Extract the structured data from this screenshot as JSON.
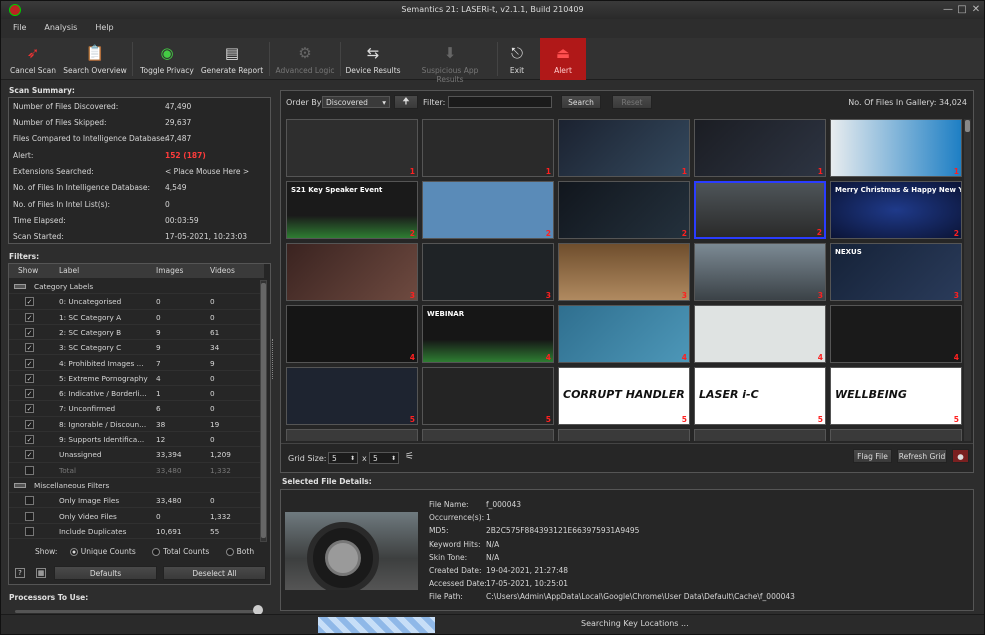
{
  "window": {
    "title": "Semantics 21: LASERi-t, v2.1.1, Build 210409"
  },
  "menu": [
    "File",
    "Analysis",
    "Help"
  ],
  "toolbar": [
    {
      "label": "Cancel Scan",
      "icon": "rocket-icon",
      "enabled": true
    },
    {
      "label": "Search Overview",
      "icon": "clipboard-icon",
      "enabled": true
    },
    {
      "label": "Toggle Privacy",
      "icon": "eye-icon",
      "enabled": true
    },
    {
      "label": "Generate Report",
      "icon": "report-icon",
      "enabled": true
    },
    {
      "label": "Advanced Logic",
      "icon": "logic-icon",
      "enabled": false
    },
    {
      "label": "Device Results",
      "icon": "usb-icon",
      "enabled": true
    },
    {
      "label": "Suspicious App Results",
      "icon": "app-icon",
      "enabled": false
    },
    {
      "label": "Exit",
      "icon": "exit-icon",
      "enabled": true
    },
    {
      "label": "Alert",
      "icon": "alarm-icon",
      "enabled": true
    }
  ],
  "scan_summary": {
    "title": "Scan Summary:",
    "rows": [
      {
        "label": "Number of Files Discovered:",
        "value": "47,490"
      },
      {
        "label": "Number of Files Skipped:",
        "value": "29,637"
      },
      {
        "label": "Files Compared to Intelligence Database:",
        "value": "47,487"
      },
      {
        "label": "Alert:",
        "value": "152 (187)"
      },
      {
        "label": "Extensions Searched:",
        "value": "< Place Mouse Here >"
      },
      {
        "label": "No. of Files In Intelligence Database:",
        "value": "4,549"
      },
      {
        "label": "No. of Files In Intel List(s):",
        "value": "0"
      },
      {
        "label": "Time Elapsed:",
        "value": "00:03:59"
      },
      {
        "label": "Scan Started:",
        "value": "17-05-2021, 10:23:03"
      }
    ]
  },
  "filters": {
    "title": "Filters:",
    "columns": [
      "Show",
      "Label",
      "Images",
      "Videos"
    ],
    "rows": [
      {
        "type": "group",
        "label": "Category Labels"
      },
      {
        "checked": true,
        "label": "0: Uncategorised",
        "images": "0",
        "videos": "0"
      },
      {
        "checked": true,
        "label": "1: SC Category A",
        "images": "0",
        "videos": "0"
      },
      {
        "checked": true,
        "label": "2: SC Category B",
        "images": "9",
        "videos": "61"
      },
      {
        "checked": true,
        "label": "3: SC Category C",
        "images": "9",
        "videos": "34"
      },
      {
        "checked": true,
        "label": "4: Prohibited Images ...",
        "images": "7",
        "videos": "9"
      },
      {
        "checked": true,
        "label": "5: Extreme Pornography",
        "images": "4",
        "videos": "0"
      },
      {
        "checked": true,
        "label": "6: Indicative / Borderli...",
        "images": "1",
        "videos": "0"
      },
      {
        "checked": true,
        "label": "7: Unconfirmed",
        "images": "6",
        "videos": "0"
      },
      {
        "checked": true,
        "label": "8: Ignorable / Discoun...",
        "images": "38",
        "videos": "19"
      },
      {
        "checked": true,
        "label": "9: Supports Identifica...",
        "images": "12",
        "videos": "0"
      },
      {
        "checked": true,
        "label": "Unassigned",
        "images": "33,394",
        "videos": "1,209"
      },
      {
        "checked": false,
        "label": "Total",
        "images": "33,480",
        "videos": "1,332"
      },
      {
        "type": "group",
        "label": "Miscellaneous Filters"
      },
      {
        "checked": false,
        "label": "Only Image Files",
        "images": "33,480",
        "videos": "0"
      },
      {
        "checked": false,
        "label": "Only Video Files",
        "images": "0",
        "videos": "1,332"
      },
      {
        "checked": false,
        "label": "Include Duplicates",
        "images": "10,691",
        "videos": "55"
      }
    ],
    "show_label": "Show:",
    "show_options": [
      "Unique Counts",
      "Total Counts",
      "Both"
    ],
    "defaults": "Defaults",
    "deselect": "Deselect All"
  },
  "processors": {
    "title": "Processors To Use:",
    "ticks": [
      "2",
      "4",
      "6",
      "8",
      "10",
      "12"
    ],
    "value": 12
  },
  "gallery": {
    "order_by_label": "Order By",
    "order_by_value": "Discovered",
    "filter_label": "Filter:",
    "filter_value": "",
    "search": "Search",
    "reset": "Reset",
    "count": "No. Of Files In Gallery: 34,024",
    "thumbs": [
      {
        "n": "1",
        "style": "blank"
      },
      {
        "n": "1",
        "style": "cube"
      },
      {
        "n": "1",
        "style": "webinar"
      },
      {
        "n": "1",
        "style": "laser"
      },
      {
        "n": "1",
        "style": "release"
      },
      {
        "n": "2",
        "style": "bcs",
        "caption": "S21 Key Speaker Event"
      },
      {
        "n": "2",
        "style": "hands"
      },
      {
        "n": "2",
        "style": "qa"
      },
      {
        "n": "2",
        "style": "tyre",
        "selected": true
      },
      {
        "n": "2",
        "style": "xmas",
        "caption": "Merry Christmas & Happy New Year"
      },
      {
        "n": "3",
        "style": "dark"
      },
      {
        "n": "3",
        "style": "door"
      },
      {
        "n": "3",
        "style": "camera"
      },
      {
        "n": "3",
        "style": "monitors"
      },
      {
        "n": "3",
        "style": "nexus",
        "caption": "NEXUS"
      },
      {
        "n": "4",
        "style": "doorway"
      },
      {
        "n": "4",
        "style": "webinar2",
        "caption": "WEBINAR"
      },
      {
        "n": "4",
        "style": "hex"
      },
      {
        "n": "4",
        "style": "coins"
      },
      {
        "n": "4",
        "style": "cofs"
      },
      {
        "n": "5",
        "style": "site"
      },
      {
        "n": "5",
        "style": "chart"
      },
      {
        "n": "5",
        "style": "logo",
        "caption": "CORRUPT HANDLER"
      },
      {
        "n": "5",
        "style": "logo",
        "caption": "LASER i-C"
      },
      {
        "n": "5",
        "style": "logo",
        "caption": "WELLBEING"
      }
    ],
    "grid_size_label": "Grid Size:",
    "grid_x": "5",
    "grid_y": "5",
    "x_sep": "x",
    "flag_file": "Flag File",
    "refresh_grid": "Refresh Grid"
  },
  "details": {
    "title": "Selected File Details:",
    "rows": [
      {
        "label": "File Name:",
        "value": "f_000043"
      },
      {
        "label": "Occurrence(s):",
        "value": "1"
      },
      {
        "label": "MD5:",
        "value": "2B2C575F884393121E663975931A9495"
      },
      {
        "label": "Keyword Hits:",
        "value": "N/A"
      },
      {
        "label": "Skin Tone:",
        "value": "N/A"
      },
      {
        "label": "Created Date:",
        "value": "19-04-2021, 21:27:48"
      },
      {
        "label": "Accessed Date:",
        "value": "17-05-2021, 10:25:01"
      },
      {
        "label": "File Path:",
        "value": "C:\\Users\\Admin\\AppData\\Local\\Google\\Chrome\\User Data\\Default\\Cache\\f_000043"
      }
    ]
  },
  "status": {
    "text": "Searching Key Locations ..."
  }
}
